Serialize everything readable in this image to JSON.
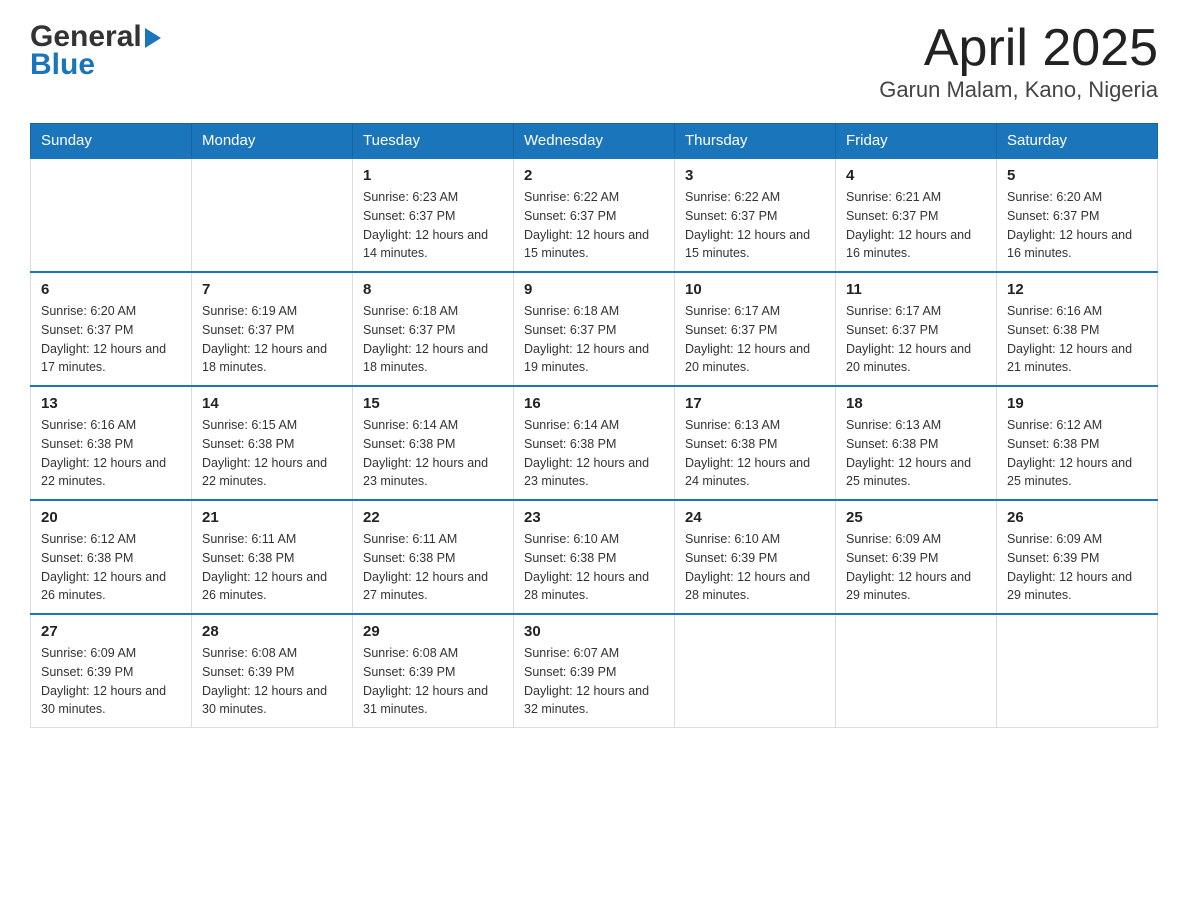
{
  "header": {
    "logo": {
      "general": "General",
      "blue": "Blue"
    },
    "title": "April 2025",
    "subtitle": "Garun Malam, Kano, Nigeria"
  },
  "calendar": {
    "days_of_week": [
      "Sunday",
      "Monday",
      "Tuesday",
      "Wednesday",
      "Thursday",
      "Friday",
      "Saturday"
    ],
    "weeks": [
      [
        {
          "day": "",
          "sunrise": "",
          "sunset": "",
          "daylight": ""
        },
        {
          "day": "",
          "sunrise": "",
          "sunset": "",
          "daylight": ""
        },
        {
          "day": "1",
          "sunrise": "Sunrise: 6:23 AM",
          "sunset": "Sunset: 6:37 PM",
          "daylight": "Daylight: 12 hours and 14 minutes."
        },
        {
          "day": "2",
          "sunrise": "Sunrise: 6:22 AM",
          "sunset": "Sunset: 6:37 PM",
          "daylight": "Daylight: 12 hours and 15 minutes."
        },
        {
          "day": "3",
          "sunrise": "Sunrise: 6:22 AM",
          "sunset": "Sunset: 6:37 PM",
          "daylight": "Daylight: 12 hours and 15 minutes."
        },
        {
          "day": "4",
          "sunrise": "Sunrise: 6:21 AM",
          "sunset": "Sunset: 6:37 PM",
          "daylight": "Daylight: 12 hours and 16 minutes."
        },
        {
          "day": "5",
          "sunrise": "Sunrise: 6:20 AM",
          "sunset": "Sunset: 6:37 PM",
          "daylight": "Daylight: 12 hours and 16 minutes."
        }
      ],
      [
        {
          "day": "6",
          "sunrise": "Sunrise: 6:20 AM",
          "sunset": "Sunset: 6:37 PM",
          "daylight": "Daylight: 12 hours and 17 minutes."
        },
        {
          "day": "7",
          "sunrise": "Sunrise: 6:19 AM",
          "sunset": "Sunset: 6:37 PM",
          "daylight": "Daylight: 12 hours and 18 minutes."
        },
        {
          "day": "8",
          "sunrise": "Sunrise: 6:18 AM",
          "sunset": "Sunset: 6:37 PM",
          "daylight": "Daylight: 12 hours and 18 minutes."
        },
        {
          "day": "9",
          "sunrise": "Sunrise: 6:18 AM",
          "sunset": "Sunset: 6:37 PM",
          "daylight": "Daylight: 12 hours and 19 minutes."
        },
        {
          "day": "10",
          "sunrise": "Sunrise: 6:17 AM",
          "sunset": "Sunset: 6:37 PM",
          "daylight": "Daylight: 12 hours and 20 minutes."
        },
        {
          "day": "11",
          "sunrise": "Sunrise: 6:17 AM",
          "sunset": "Sunset: 6:37 PM",
          "daylight": "Daylight: 12 hours and 20 minutes."
        },
        {
          "day": "12",
          "sunrise": "Sunrise: 6:16 AM",
          "sunset": "Sunset: 6:38 PM",
          "daylight": "Daylight: 12 hours and 21 minutes."
        }
      ],
      [
        {
          "day": "13",
          "sunrise": "Sunrise: 6:16 AM",
          "sunset": "Sunset: 6:38 PM",
          "daylight": "Daylight: 12 hours and 22 minutes."
        },
        {
          "day": "14",
          "sunrise": "Sunrise: 6:15 AM",
          "sunset": "Sunset: 6:38 PM",
          "daylight": "Daylight: 12 hours and 22 minutes."
        },
        {
          "day": "15",
          "sunrise": "Sunrise: 6:14 AM",
          "sunset": "Sunset: 6:38 PM",
          "daylight": "Daylight: 12 hours and 23 minutes."
        },
        {
          "day": "16",
          "sunrise": "Sunrise: 6:14 AM",
          "sunset": "Sunset: 6:38 PM",
          "daylight": "Daylight: 12 hours and 23 minutes."
        },
        {
          "day": "17",
          "sunrise": "Sunrise: 6:13 AM",
          "sunset": "Sunset: 6:38 PM",
          "daylight": "Daylight: 12 hours and 24 minutes."
        },
        {
          "day": "18",
          "sunrise": "Sunrise: 6:13 AM",
          "sunset": "Sunset: 6:38 PM",
          "daylight": "Daylight: 12 hours and 25 minutes."
        },
        {
          "day": "19",
          "sunrise": "Sunrise: 6:12 AM",
          "sunset": "Sunset: 6:38 PM",
          "daylight": "Daylight: 12 hours and 25 minutes."
        }
      ],
      [
        {
          "day": "20",
          "sunrise": "Sunrise: 6:12 AM",
          "sunset": "Sunset: 6:38 PM",
          "daylight": "Daylight: 12 hours and 26 minutes."
        },
        {
          "day": "21",
          "sunrise": "Sunrise: 6:11 AM",
          "sunset": "Sunset: 6:38 PM",
          "daylight": "Daylight: 12 hours and 26 minutes."
        },
        {
          "day": "22",
          "sunrise": "Sunrise: 6:11 AM",
          "sunset": "Sunset: 6:38 PM",
          "daylight": "Daylight: 12 hours and 27 minutes."
        },
        {
          "day": "23",
          "sunrise": "Sunrise: 6:10 AM",
          "sunset": "Sunset: 6:38 PM",
          "daylight": "Daylight: 12 hours and 28 minutes."
        },
        {
          "day": "24",
          "sunrise": "Sunrise: 6:10 AM",
          "sunset": "Sunset: 6:39 PM",
          "daylight": "Daylight: 12 hours and 28 minutes."
        },
        {
          "day": "25",
          "sunrise": "Sunrise: 6:09 AM",
          "sunset": "Sunset: 6:39 PM",
          "daylight": "Daylight: 12 hours and 29 minutes."
        },
        {
          "day": "26",
          "sunrise": "Sunrise: 6:09 AM",
          "sunset": "Sunset: 6:39 PM",
          "daylight": "Daylight: 12 hours and 29 minutes."
        }
      ],
      [
        {
          "day": "27",
          "sunrise": "Sunrise: 6:09 AM",
          "sunset": "Sunset: 6:39 PM",
          "daylight": "Daylight: 12 hours and 30 minutes."
        },
        {
          "day": "28",
          "sunrise": "Sunrise: 6:08 AM",
          "sunset": "Sunset: 6:39 PM",
          "daylight": "Daylight: 12 hours and 30 minutes."
        },
        {
          "day": "29",
          "sunrise": "Sunrise: 6:08 AM",
          "sunset": "Sunset: 6:39 PM",
          "daylight": "Daylight: 12 hours and 31 minutes."
        },
        {
          "day": "30",
          "sunrise": "Sunrise: 6:07 AM",
          "sunset": "Sunset: 6:39 PM",
          "daylight": "Daylight: 12 hours and 32 minutes."
        },
        {
          "day": "",
          "sunrise": "",
          "sunset": "",
          "daylight": ""
        },
        {
          "day": "",
          "sunrise": "",
          "sunset": "",
          "daylight": ""
        },
        {
          "day": "",
          "sunrise": "",
          "sunset": "",
          "daylight": ""
        }
      ]
    ]
  }
}
